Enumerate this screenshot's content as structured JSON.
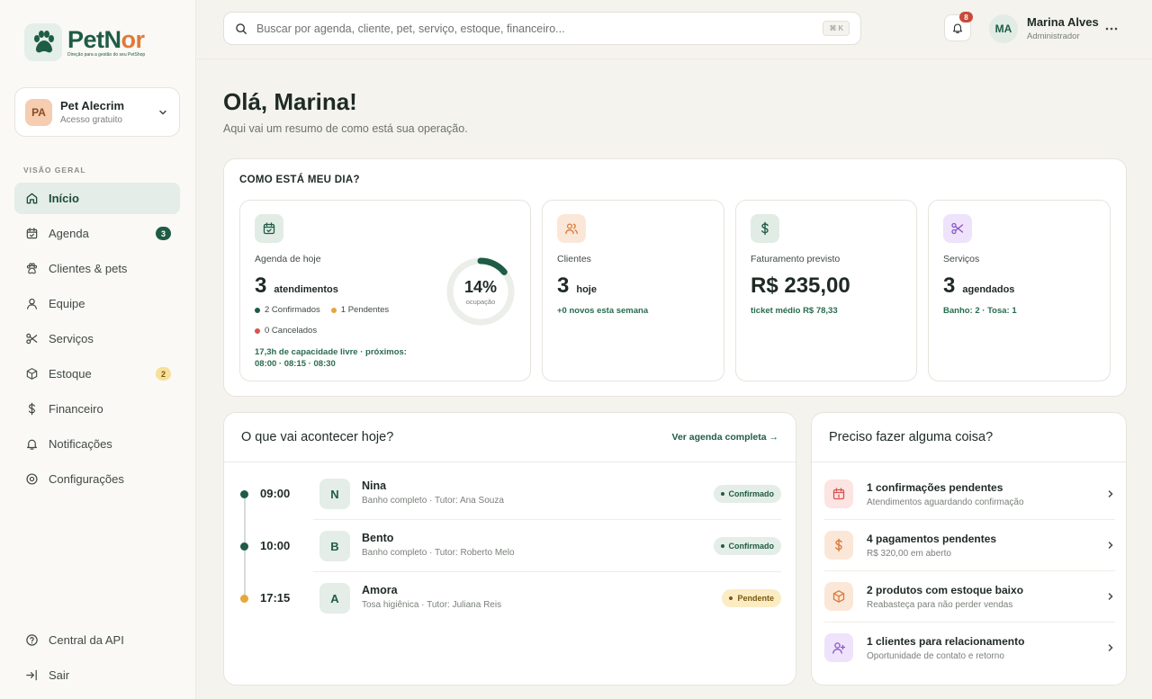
{
  "brand": {
    "name_prefix": "PetN",
    "name_accent": "or",
    "tagline": "Direção para a gestão do seu PetShop"
  },
  "store": {
    "avatar": "PA",
    "name": "Pet Alecrim",
    "plan": "Acesso gratuito"
  },
  "sidebar": {
    "section": "VISÃO GERAL",
    "items": [
      {
        "label": "Início",
        "icon": "home-icon",
        "active": true
      },
      {
        "label": "Agenda",
        "icon": "calendar-icon",
        "badge": "3"
      },
      {
        "label": "Clientes & pets",
        "icon": "paw-icon"
      },
      {
        "label": "Equipe",
        "icon": "user-icon"
      },
      {
        "label": "Serviços",
        "icon": "scissors-icon"
      },
      {
        "label": "Estoque",
        "icon": "box-icon",
        "badge": "2"
      },
      {
        "label": "Financeiro",
        "icon": "dollar-icon"
      },
      {
        "label": "Notificações",
        "icon": "bell-icon"
      },
      {
        "label": "Configurações",
        "icon": "gear-icon"
      }
    ],
    "bottom": [
      {
        "label": "Central da API",
        "icon": "help-icon"
      },
      {
        "label": "Sair",
        "icon": "logout-icon"
      }
    ]
  },
  "topbar": {
    "search_placeholder": "Buscar por agenda, cliente, pet, serviço, estoque, financeiro...",
    "shortcut": "⌘ K",
    "notifications": "8",
    "user": {
      "initials": "MA",
      "name": "Marina Alves",
      "role": "Administrador"
    }
  },
  "greeting": {
    "title": "Olá, Marina!",
    "subtitle": "Aqui vai um resumo de como está sua operação."
  },
  "day": {
    "title": "COMO ESTÁ MEU DIA?",
    "agenda": {
      "label": "Agenda de hoje",
      "value": "3",
      "unit": "atendimentos",
      "confirmed": "2 Confirmados",
      "pending": "1 Pendentes",
      "canceled": "0 Cancelados",
      "capacity": "17,3h de capacidade livre · próximos: 08:00 · 08:15 · 08:30",
      "occupancy_pct": "14%",
      "occupancy_value": 14,
      "occupancy_label": "ocupação"
    },
    "clients": {
      "label": "Clientes",
      "value": "3",
      "unit": "hoje",
      "note": "+0 novos esta semana"
    },
    "revenue": {
      "label": "Faturamento previsto",
      "value": "R$ 235,00",
      "note": "ticket médio R$ 78,33"
    },
    "services": {
      "label": "Serviços",
      "value": "3",
      "unit": "agendados",
      "note": "Banho: 2 · Tosa: 1"
    }
  },
  "today": {
    "title": "O que vai acontecer hoje?",
    "link": "Ver agenda completa →",
    "appointments": [
      {
        "time": "09:00",
        "initial": "N",
        "name": "Nina",
        "desc": "Banho completo · Tutor: Ana Souza",
        "status": "Confirmado",
        "status_color": "#1f5c45"
      },
      {
        "time": "10:00",
        "initial": "B",
        "name": "Bento",
        "desc": "Banho completo · Tutor: Roberto Melo",
        "status": "Confirmado",
        "status_color": "#1f5c45"
      },
      {
        "time": "17:15",
        "initial": "A",
        "name": "Amora",
        "desc": "Tosa higiênica · Tutor: Juliana Reis",
        "status": "Pendente",
        "status_color": "#e8a63a"
      }
    ]
  },
  "todo": {
    "title": "Preciso fazer alguma coisa?",
    "items": [
      {
        "title": "1 confirmações pendentes",
        "sub": "Atendimentos aguardando confirmação",
        "icon": "calendar-icon",
        "color": "#d9534f",
        "bg": "#fbe4e2"
      },
      {
        "title": "4 pagamentos pendentes",
        "sub": "R$ 320,00 em aberto",
        "icon": "dollar-icon",
        "color": "#d97a3a",
        "bg": "#fbe7d8"
      },
      {
        "title": "2 produtos com estoque baixo",
        "sub": "Reabasteça para não perder vendas",
        "icon": "box-icon",
        "color": "#d97a3a",
        "bg": "#fbe7d8"
      },
      {
        "title": "1 clientes para relacionamento",
        "sub": "Oportunidade de contato e retorno",
        "icon": "user-plus-icon",
        "color": "#8a55c9",
        "bg": "#eee3fa"
      }
    ]
  },
  "colors": {
    "primary": "#1f5c45",
    "accent": "#e07a3a",
    "confirmed": "#1f5c45",
    "pending": "#e8a63a",
    "canceled": "#d9534f"
  }
}
